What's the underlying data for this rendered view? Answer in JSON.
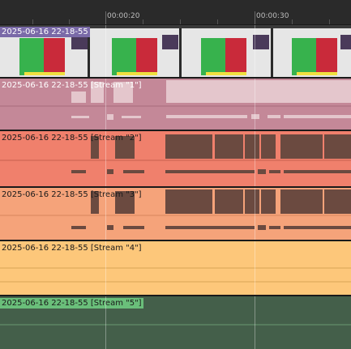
{
  "ruler": {
    "timecodes": [
      "00:00:20",
      "00:00:30"
    ]
  },
  "tracks": {
    "video": {
      "label": "2025-06-16 22-18-55",
      "color": "#8a7bb0"
    },
    "stream1": {
      "label": "2025-06-16 22-18-55 [Stream \"1\"]",
      "color": "#c98a9a"
    },
    "stream2": {
      "label": "2025-06-16 22-18-55 [Stream \"2\"]",
      "color": "#f0806c"
    },
    "stream3": {
      "label": "2025-06-16 22-18-55 [Stream \"3\"]",
      "color": "#f5a37a"
    },
    "stream4": {
      "label": "2025-06-16 22-18-55 [Stream \"4\"]",
      "color": "#fdc77a"
    },
    "stream5": {
      "label": "2025-06-16 22-18-55 [Stream \"5\"]",
      "color": "#4a6b50"
    }
  },
  "colors": {
    "playhead": "#ffffff",
    "waveform_dark": "#6b4a40",
    "waveform_light": "#e8c8cc"
  }
}
